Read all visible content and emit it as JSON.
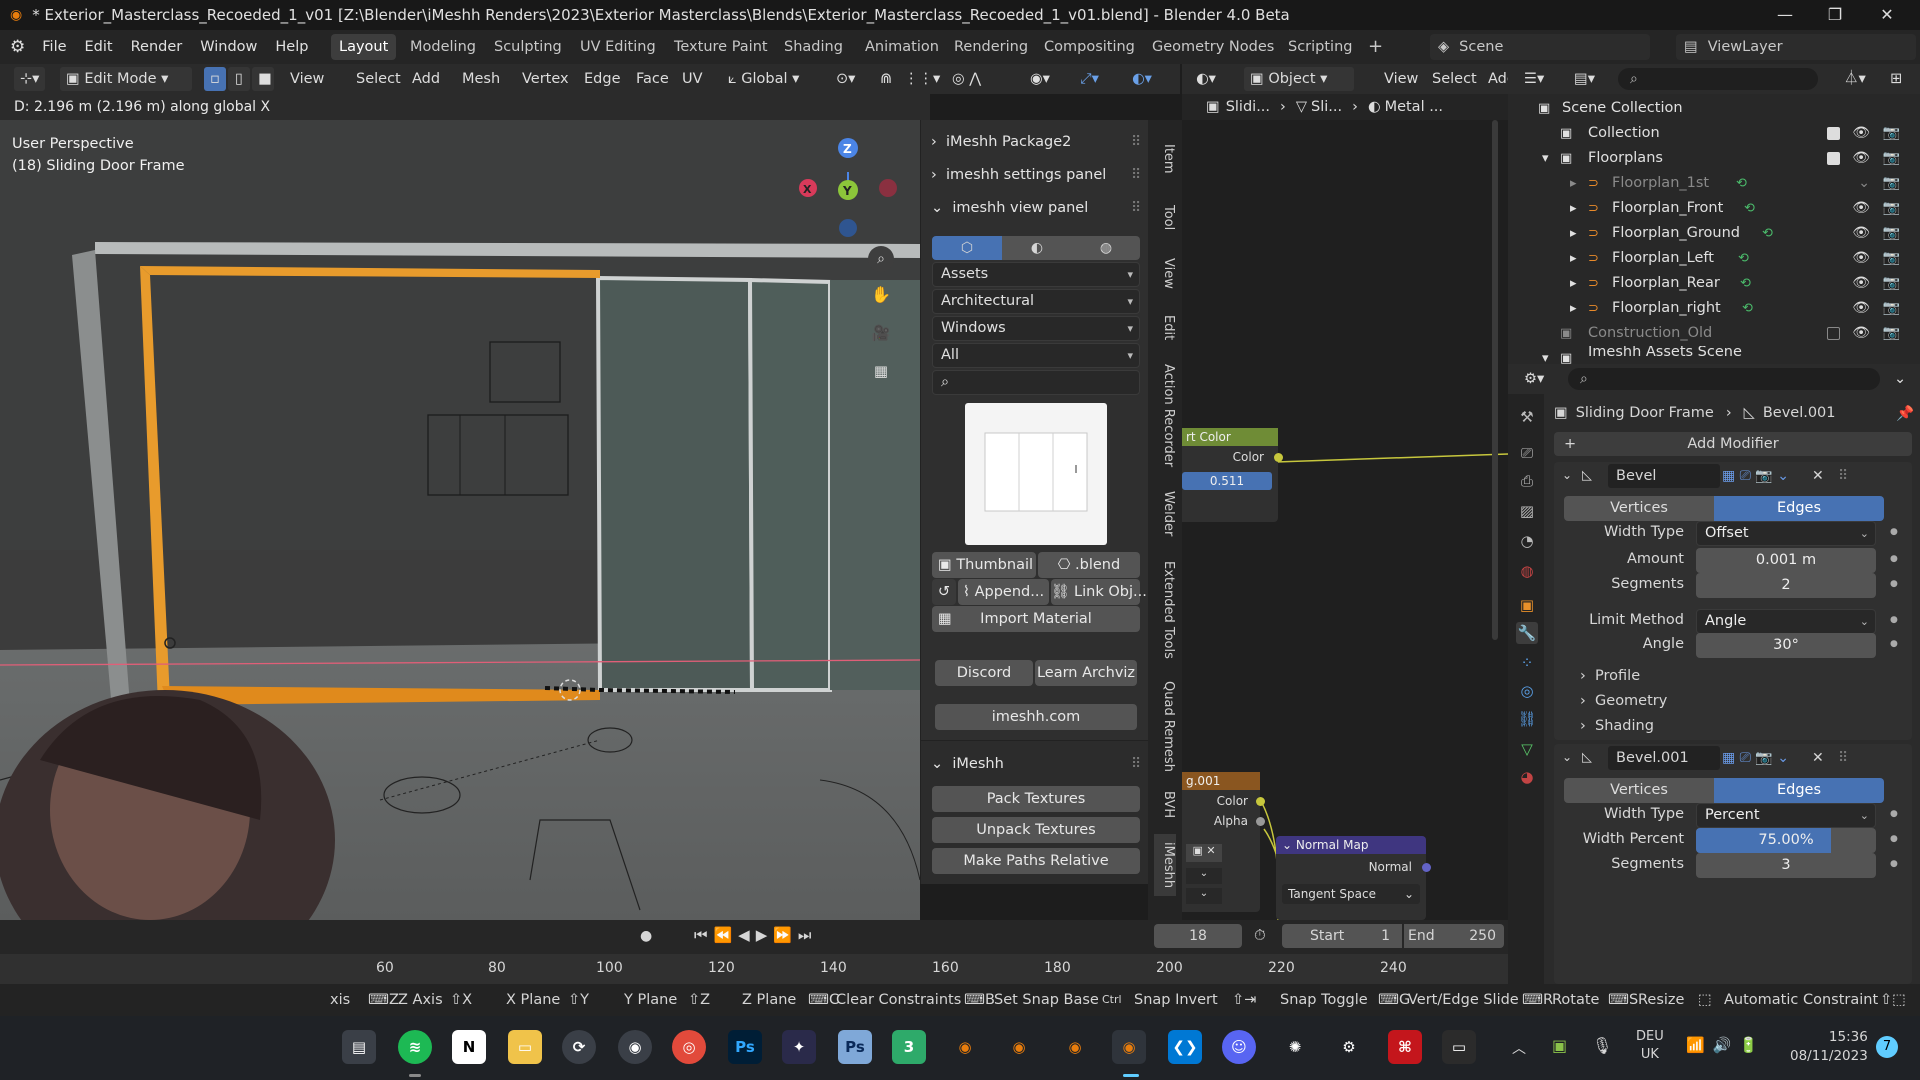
{
  "window": {
    "title": "* Exterior_Masterclass_Recoeded_1_v01 [Z:\\Blender\\iMeshh Renders\\2023\\Exterior Masterclass\\Blends\\Exterior_Masterclass_Recoeded_1_v01.blend] - Blender 4.0 Beta"
  },
  "menu": {
    "file": "File",
    "edit": "Edit",
    "render": "Render",
    "window": "Window",
    "help": "Help"
  },
  "workspaces": [
    "Layout",
    "Modeling",
    "Sculpting",
    "UV Editing",
    "Texture Paint",
    "Shading",
    "Animation",
    "Rendering",
    "Compositing",
    "Geometry Nodes",
    "Scripting"
  ],
  "scene": {
    "scene_label": "Scene",
    "viewlayer_label": "ViewLayer"
  },
  "header3d": {
    "mode": "Edit Mode",
    "view": "View",
    "select": "Select",
    "add": "Add",
    "mesh": "Mesh",
    "vertex": "Vertex",
    "edge": "Edge",
    "face": "Face",
    "uv": "UV",
    "orientation": "Global"
  },
  "node_header": {
    "object": "Object",
    "view": "View",
    "select": "Select",
    "add": "Add"
  },
  "breadcrumb": {
    "a": "Slidi...",
    "b": "Sli...",
    "c": "Metal ..."
  },
  "operator_status": "D: 2.196 m (2.196 m) along global X",
  "viewport": {
    "perspective": "User Perspective",
    "object": "(18) Sliding Door Frame"
  },
  "npanel": {
    "pkg2": "iMeshh Package2",
    "settings": "imeshh settings panel",
    "view_panel": "imeshh view panel",
    "dd1": "Assets",
    "dd2": "Architectural",
    "dd3": "Windows",
    "dd4": "All",
    "thumbnail": "Thumbnail",
    "blend": ".blend",
    "append": "Append...",
    "link": "Link Obj...",
    "import_material": "Import Material",
    "discord": "Discord",
    "learn": "Learn Archviz",
    "site": "imeshh.com",
    "imeshh": "iMeshh",
    "pack": "Pack Textures",
    "unpack": "Unpack Textures",
    "relative": "Make Paths Relative"
  },
  "vtabs": [
    "Item",
    "Tool",
    "View",
    "Edit",
    "Action Recorder",
    "Welder",
    "Extended Tools",
    "Quad Remesh",
    "BVH",
    "iMeshh"
  ],
  "nodes": {
    "n1_title": "rt Color",
    "n1_color": "Color",
    "n1_value": "0.511",
    "n2_title": "g.001",
    "n2_color": "Color",
    "n2_alpha": "Alpha",
    "nm_title": "Normal Map",
    "nm_normal": "Normal",
    "nm_space": "Tangent Space"
  },
  "outliner": {
    "root": "Scene Collection",
    "rows": [
      "Collection",
      "Floorplans",
      "Floorplan_1st",
      "Floorplan_Front",
      "Floorplan_Ground",
      "Floorplan_Left",
      "Floorplan_Rear",
      "Floorplan_right",
      "Construction_Old",
      "Imeshh Assets Scene"
    ]
  },
  "properties": {
    "object": "Sliding Door Frame",
    "modifier_path": "Bevel.001",
    "add_modifier": "Add Modifier",
    "bevel1": {
      "name": "Bevel",
      "vertices": "Vertices",
      "edges": "Edges",
      "width_type_label": "Width Type",
      "width_type": "Offset",
      "amount_label": "Amount",
      "amount": "0.001 m",
      "segments_label": "Segments",
      "segments": "2",
      "limit_label": "Limit Method",
      "limit": "Angle",
      "angle_label": "Angle",
      "angle": "30°",
      "profile": "Profile",
      "geometry": "Geometry",
      "shading": "Shading"
    },
    "bevel2": {
      "name": "Bevel.001",
      "vertices": "Vertices",
      "edges": "Edges",
      "width_type_label": "Width Type",
      "width_type": "Percent",
      "width_pct_label": "Width Percent",
      "width_pct": "75.00%",
      "width_pct_value": 75,
      "segments_label": "Segments",
      "segments": "3"
    }
  },
  "timeline": {
    "frame": "18",
    "start_label": "Start",
    "start": "1",
    "end_label": "End",
    "end": "250",
    "ticks": [
      "60",
      "80",
      "100",
      "120",
      "140",
      "160",
      "180",
      "200",
      "220",
      "240"
    ]
  },
  "statusbar": {
    "axis": "xis",
    "z_axis": "Z Axis",
    "x_plane": "X Plane",
    "y_plane": "Y Plane",
    "z_plane": "Z Plane",
    "clear": "Clear Constraints",
    "snap_base": "Set Snap Base",
    "snap_invert": "Snap Invert",
    "snap_toggle": "Snap Toggle",
    "vert_slide": "Vert/Edge Slide",
    "rotate": "Rotate",
    "resize": "Resize",
    "auto_constraint": "Automatic Constraint"
  },
  "keys": {
    "z": "Z",
    "x": "X",
    "y": "Y",
    "c": "C",
    "b": "B",
    "ctrl": "Ctrl",
    "g": "G",
    "r": "R",
    "s": "S"
  },
  "taskbar": {
    "lang": "DEU",
    "region": "UK",
    "time": "15:36",
    "date": "08/11/2023",
    "notifications": "7",
    "n_label": "N",
    "ps_label": "Ps",
    "three_label": "3"
  }
}
